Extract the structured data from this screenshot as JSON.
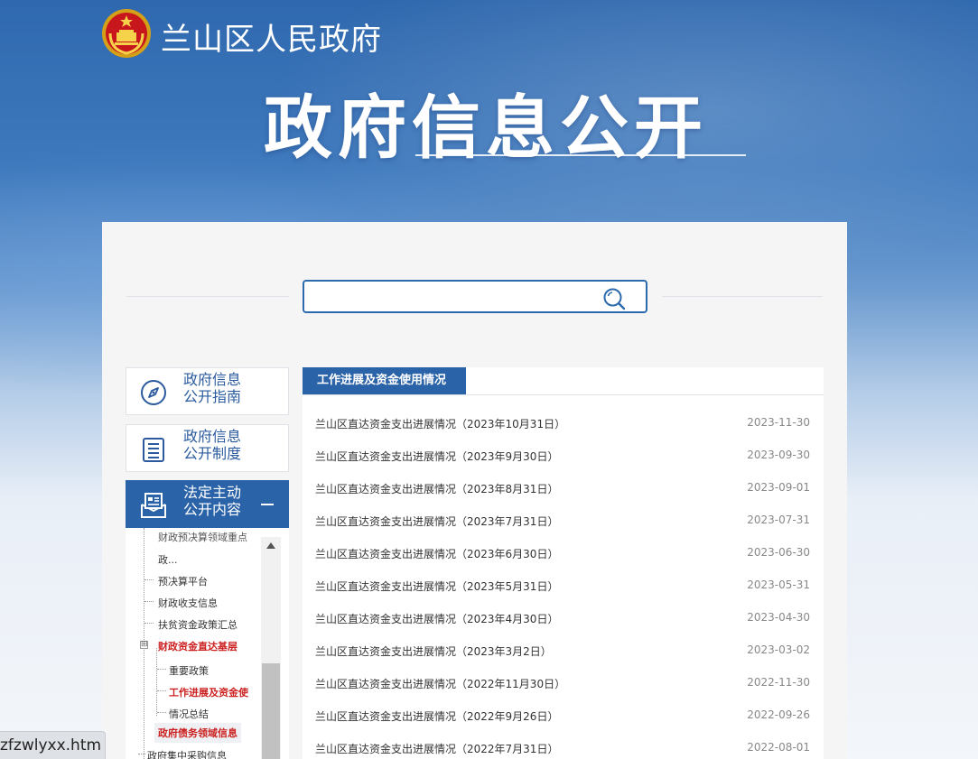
{
  "header": {
    "site_name": "兰山区人民政府",
    "big_title": "政府信息公开"
  },
  "search": {
    "placeholder": "",
    "value": ""
  },
  "nav": [
    {
      "label": "政府信息\n公开指南",
      "icon": "compass-icon"
    },
    {
      "label": "政府信息\n公开制度",
      "icon": "list-document-icon"
    },
    {
      "label": "法定主动\n公开内容",
      "icon": "newspaper-icon",
      "collapse": "minus-icon"
    }
  ],
  "tree": {
    "items": [
      {
        "label": "财政预决算领域重点"
      },
      {
        "label": "政..."
      },
      {
        "label": "预决算平台"
      },
      {
        "label": "财政收支信息"
      },
      {
        "label": "扶贫资金政策汇总"
      },
      {
        "label": "财政资金直达基层"
      },
      {
        "label": "重要政策"
      },
      {
        "label": "工作进展及资金使"
      },
      {
        "label": "情况总结"
      },
      {
        "label": "政府债务领域信息"
      },
      {
        "label": "政府集中采购信息"
      }
    ]
  },
  "content": {
    "tab_label": "工作进展及资金使用情况",
    "rows": [
      {
        "title": "兰山区直达资金支出进展情况（2023年10月31日）",
        "date": "2023-11-30"
      },
      {
        "title": "兰山区直达资金支出进展情况（2023年9月30日）",
        "date": "2023-09-30"
      },
      {
        "title": "兰山区直达资金支出进展情况（2023年8月31日）",
        "date": "2023-09-01"
      },
      {
        "title": "兰山区直达资金支出进展情况（2023年7月31日）",
        "date": "2023-07-31"
      },
      {
        "title": "兰山区直达资金支出进展情况（2023年6月30日）",
        "date": "2023-06-30"
      },
      {
        "title": "兰山区直达资金支出进展情况（2023年5月31日）",
        "date": "2023-05-31"
      },
      {
        "title": "兰山区直达资金支出进展情况（2023年4月30日）",
        "date": "2023-04-30"
      },
      {
        "title": "兰山区直达资金支出进展情况（2023年3月2日）",
        "date": "2023-03-02"
      },
      {
        "title": "兰山区直达资金支出进展情况（2022年11月30日）",
        "date": "2022-11-30"
      },
      {
        "title": "兰山区直达资金支出进展情况（2022年9月26日）",
        "date": "2022-09-26"
      },
      {
        "title": "兰山区直达资金支出进展情况（2022年7月31日）",
        "date": "2022-08-01"
      }
    ]
  },
  "status_bar": {
    "url": "zfzwlyxx.htm"
  },
  "colors": {
    "primary": "#2b63a8",
    "highlight_red": "#cc1f1f"
  }
}
